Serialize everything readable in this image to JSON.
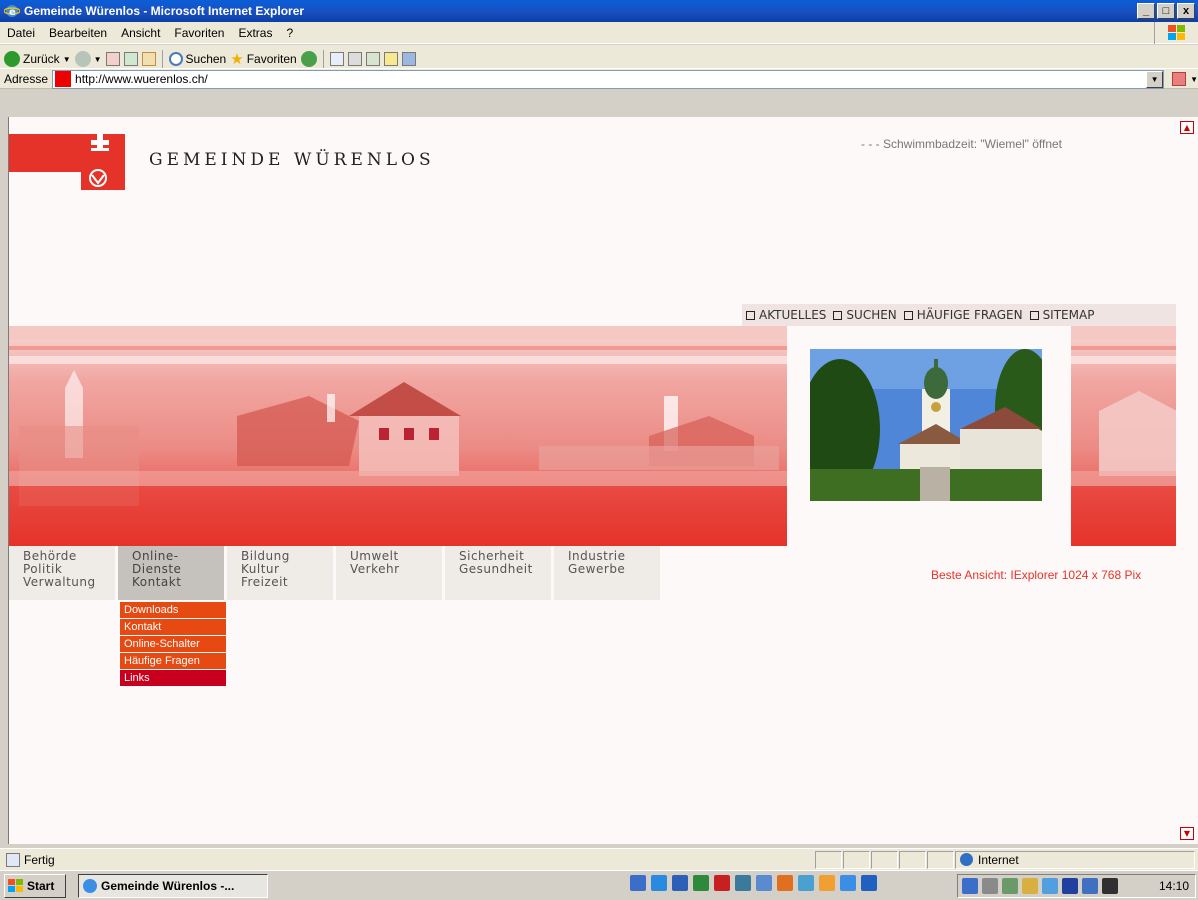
{
  "window": {
    "title": "Gemeinde Würenlos - Microsoft Internet Explorer",
    "buttons": [
      "_",
      "□",
      "x"
    ]
  },
  "menubar": {
    "items": [
      "Datei",
      "Bearbeiten",
      "Ansicht",
      "Favoriten",
      "Extras",
      "?"
    ]
  },
  "toolbar": {
    "back_label": "Zurück",
    "search_label": "Suchen",
    "favorites_label": "Favoriten",
    "address_label": "Adresse",
    "address_url": "http://www.wuerenlos.ch/"
  },
  "page": {
    "site_name": "GEMEINDE WÜRENLOS",
    "ticker": "- - - Schwimmbadzeit: \"Wiemel\" öffnet",
    "top_nav": [
      "AKTUELLES",
      "SUCHEN",
      "HÄUFIGE FRAGEN",
      "SITEMAP"
    ],
    "main_nav": [
      {
        "lines": [
          "Behörde",
          "Politik",
          "Verwaltung"
        ],
        "active": false
      },
      {
        "lines": [
          "Online-",
          "Dienste",
          "Kontakt"
        ],
        "active": true
      },
      {
        "lines": [
          "Bildung",
          "Kultur",
          "Freizeit"
        ],
        "active": false
      },
      {
        "lines": [
          "Umwelt",
          "Verkehr",
          ""
        ],
        "active": false
      },
      {
        "lines": [
          "Sicherheit",
          "Gesundheit",
          ""
        ],
        "active": false
      },
      {
        "lines": [
          "Industrie",
          "Gewerbe",
          ""
        ],
        "active": false
      }
    ],
    "submenu": [
      "Downloads",
      "Kontakt",
      "Online-Schalter",
      "Häufige Fragen",
      "Links"
    ],
    "best_view": "Beste Ansicht: IExplorer 1024 x 768 Pix",
    "brand_red": "#e5332a"
  },
  "statusbar": {
    "status": "Fertig",
    "zone": "Internet"
  },
  "taskbar": {
    "start_label": "Start",
    "task_label": "Gemeinde Würenlos -...",
    "clock": "14:10"
  }
}
